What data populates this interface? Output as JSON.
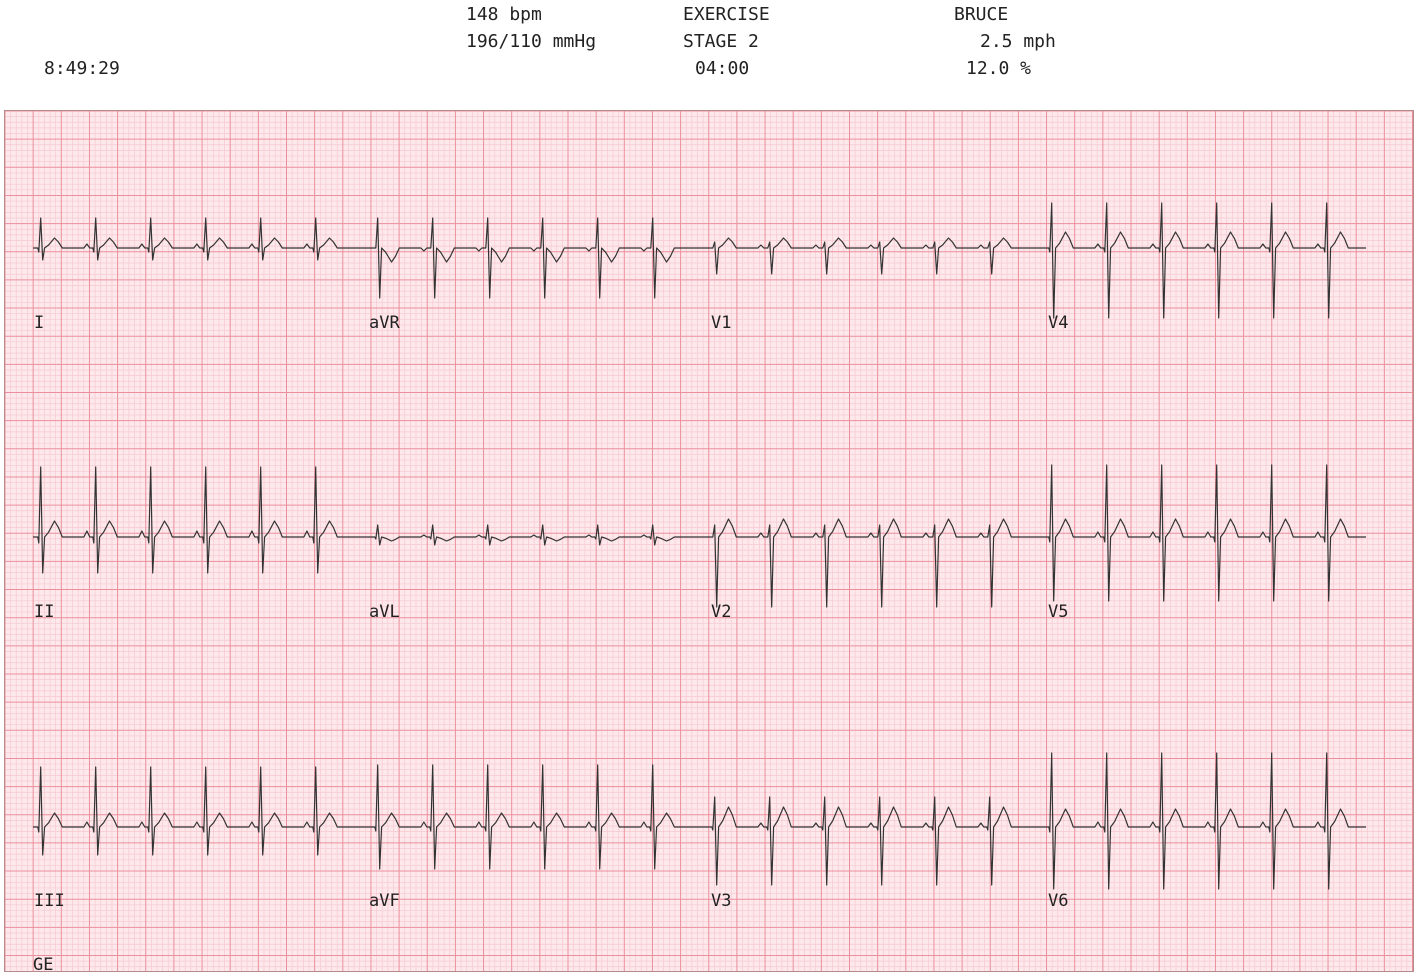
{
  "header": {
    "time": "8:49:29",
    "heart_rate": "148 bpm",
    "blood_pressure": "196/110 mmHg",
    "phase": "EXERCISE",
    "stage": "STAGE 2",
    "stage_time": "04:00",
    "protocol": "BRUCE",
    "speed": "2.5 mph",
    "grade": "12.0 %"
  },
  "leads": {
    "row1": [
      "I",
      "aVR",
      "V1",
      "V4"
    ],
    "row2": [
      "II",
      "aVL",
      "V2",
      "V5"
    ],
    "row3": [
      "III",
      "aVF",
      "V3",
      "V6"
    ]
  },
  "footer": {
    "brand": "GE"
  },
  "colors": {
    "grid_minor": "#f6c9d0",
    "grid_major": "#ec8f9c",
    "paper": "#fde9ec",
    "trace": "#333333"
  }
}
